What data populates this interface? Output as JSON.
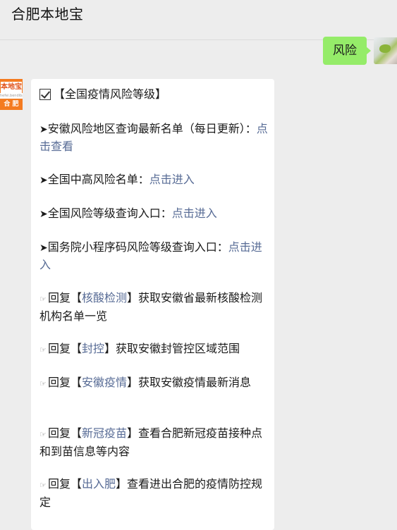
{
  "header": {
    "title": "合肥本地宝"
  },
  "outgoing": {
    "text": "风险"
  },
  "account_avatar": {
    "logo_text": "本地宝",
    "url_text": "hefei.bendibao.com",
    "city": "合 肥"
  },
  "message": {
    "heading": "【全国疫情风险等级】",
    "item1": {
      "prefix": "➤",
      "text": "安徽风险地区查询最新名单（每日更新）：",
      "link": "点击查看"
    },
    "item2": {
      "prefix": "➤",
      "text": "全国中高风险名单：",
      "link": "点击进入"
    },
    "item3": {
      "prefix": "➤",
      "text": "全国风险等级查询入口：",
      "link": "点击进入"
    },
    "item4": {
      "prefix": "➤",
      "text": "国务院小程序码风险等级查询入口：",
      "link": "点击进入"
    },
    "reply1": {
      "icon": "☞",
      "pre": "回复【",
      "kw": "核酸检测",
      "post": "】获取安徽省最新核酸检测机构名单一览"
    },
    "reply2": {
      "icon": "☞",
      "pre": "回复【",
      "kw": "封控",
      "post": "】获取安徽封管控区域范围"
    },
    "reply3": {
      "icon": "☞",
      "pre": "回复【",
      "kw": "安徽疫情",
      "post": "】获取安徽疫情最新消息"
    },
    "reply4": {
      "icon": "☞",
      "pre": "回复【",
      "kw": "新冠疫苗",
      "post": "】查看合肥新冠疫苗接种点和到苗信息等内容"
    },
    "reply5": {
      "icon": "☞",
      "pre": "回复【",
      "kw": "出入肥",
      "post": "】查看进出合肥的疫情防控规定"
    }
  }
}
